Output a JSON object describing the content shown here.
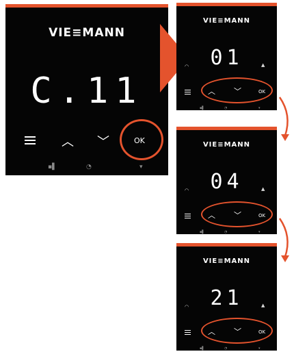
{
  "brand": "VIE≡MANN",
  "accent_color": "#e4532d",
  "main": {
    "code": "C.11",
    "ok_label": "OK"
  },
  "steps": [
    {
      "value": "01",
      "ok_label": "OK"
    },
    {
      "value": "04",
      "ok_label": "OK"
    },
    {
      "value": "21",
      "ok_label": "OK"
    }
  ],
  "icons": [
    "menu-icon",
    "chevron-up-icon",
    "chevron-down-icon",
    "wifi-icon",
    "flame-icon",
    "arrow-icon"
  ]
}
